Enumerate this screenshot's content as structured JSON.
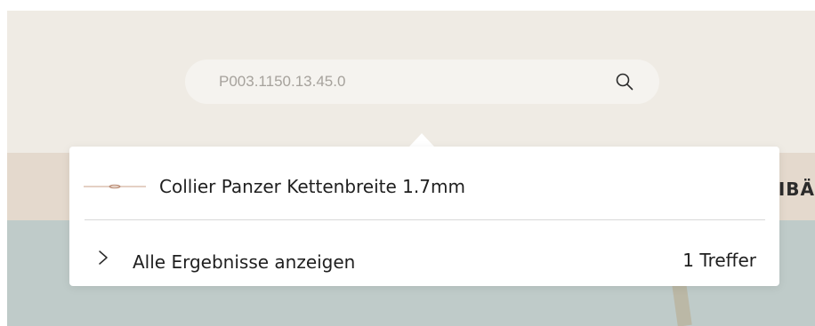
{
  "search": {
    "value": "P003.1150.13.45.0",
    "icon": "search-icon"
  },
  "nav": {
    "peek_text": "IBÄ"
  },
  "results": {
    "items": [
      {
        "title": "Collier Panzer Kettenbreite 1.7mm",
        "icon": "necklace-thumbnail"
      }
    ],
    "show_all_label": "Alle Ergebnisse anzeigen",
    "hit_count": "1 Treffer"
  },
  "colors": {
    "header_bg": "#efebe4",
    "nav_bg": "#e4d9cd",
    "search_bg": "#f5f3ef",
    "hero_bg": "#bfcbc9",
    "text": "#1f1f1f",
    "placeholder": "#a6a29c"
  }
}
